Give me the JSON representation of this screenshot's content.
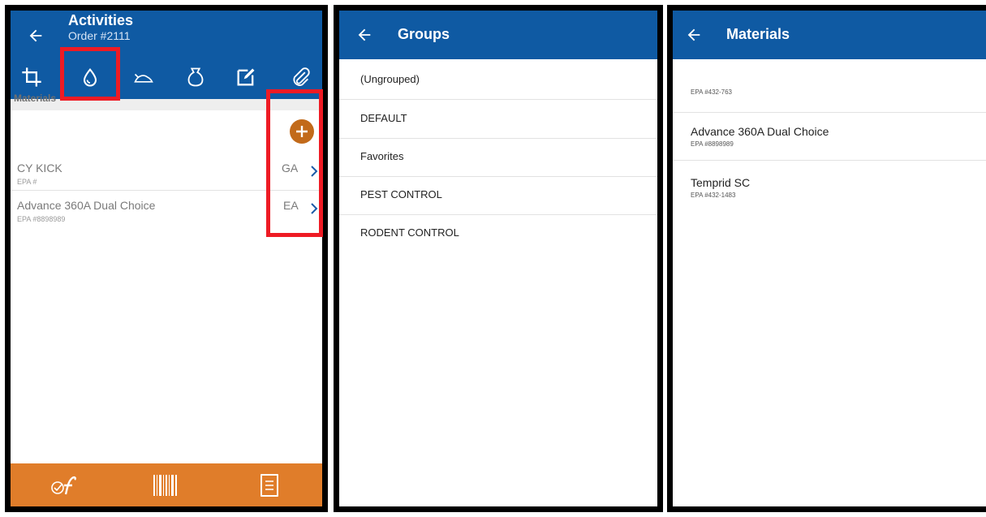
{
  "activities_screen": {
    "title": "Activities",
    "order": "Order #2111",
    "tabs": [
      "crop-icon",
      "droplet-icon",
      "mouse-icon",
      "bag-icon",
      "edit-icon",
      "paperclip-icon"
    ],
    "section_label": "Materials",
    "rows": [
      {
        "name": "CY KICK",
        "epa": "EPA #",
        "unit": "GA"
      },
      {
        "name": "Advance 360A Dual Choice",
        "epa": "EPA #8898989",
        "unit": "EA"
      }
    ],
    "bottom_icons": [
      "signature-icon",
      "barcode-icon",
      "document-icon"
    ],
    "colors": {
      "appbar": "#0f5aa3",
      "bottombar": "#e07d2a",
      "highlight": "#ee1b24",
      "add_button": "#c26a1a"
    }
  },
  "groups_screen": {
    "title": "Groups",
    "items": [
      "(Ungrouped)",
      "DEFAULT",
      "Favorites",
      "PEST CONTROL",
      "RODENT CONTROL"
    ]
  },
  "materials_screen": {
    "title": "Materials",
    "header_epa": "EPA #432-763",
    "items": [
      {
        "name": "Advance 360A Dual Choice",
        "epa": "EPA #8898989"
      },
      {
        "name": "Temprid SC",
        "epa": "EPA #432-1483"
      }
    ]
  }
}
